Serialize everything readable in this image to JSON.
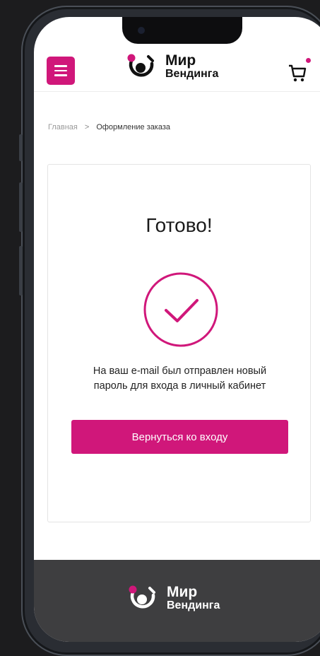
{
  "brand": {
    "line1": "Мир",
    "line2": "Вендинга",
    "accent_color": "#d0177a"
  },
  "header": {
    "menu_icon": "hamburger-icon",
    "cart_icon": "cart-icon"
  },
  "breadcrumb": {
    "home": "Главная",
    "separator": ">",
    "current": "Оформление заказа"
  },
  "card": {
    "title": "Готово!",
    "status_icon": "check-circle-icon",
    "message_line1": "На ваш e-mail был отправлен новый",
    "message_line2": "пароль для входа в личный кабинет",
    "button_label": "Вернуться ко входу"
  },
  "footer": {
    "line1": "Мир",
    "line2": "Вендинга"
  }
}
